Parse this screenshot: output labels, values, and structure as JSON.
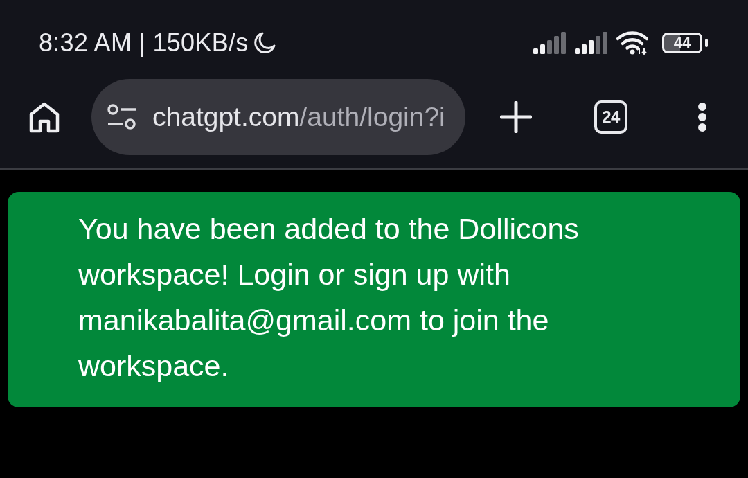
{
  "status_bar": {
    "status_text": "8:32 AM | 150KB/s",
    "battery": "44"
  },
  "browser_toolbar": {
    "url_host": "chatgpt.com",
    "url_path": "/auth/login?i",
    "tab_count": "24"
  },
  "banner": {
    "message": "You have been added to the Dollicons workspace! Login or sign up with manikabalita@gmail.com to join the workspace."
  }
}
